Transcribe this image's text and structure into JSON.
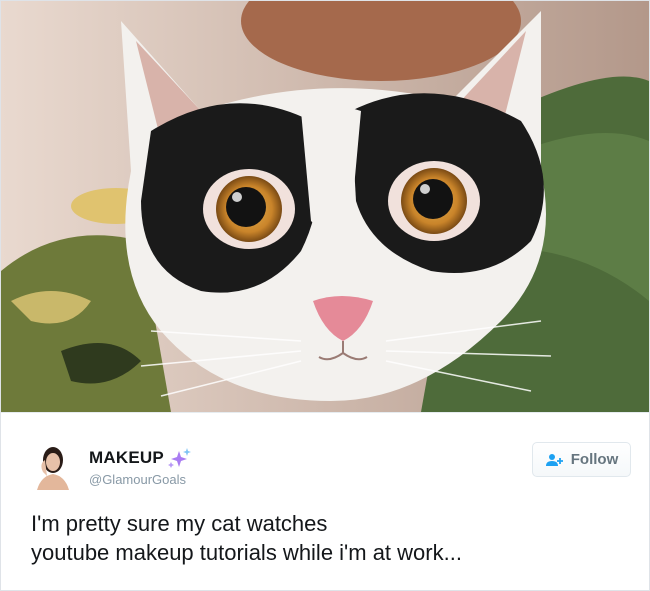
{
  "tweet": {
    "photo_icon": "cat-photo",
    "author": {
      "display_name": "MAKEUP",
      "badge_icon": "sparkles-icon",
      "handle": "@GlamourGoals",
      "avatar_icon": "avatar-portrait"
    },
    "follow_button": {
      "label": "Follow",
      "icon": "follow-person-plus-icon"
    },
    "text_lines": [
      "I'm pretty sure my cat watches",
      "youtube makeup tutorials while i'm at work..."
    ]
  },
  "colors": {
    "follow_icon": "#1da1f2",
    "sparkle": "#a97cf2",
    "handle": "#8899a6",
    "text": "#14171a"
  }
}
